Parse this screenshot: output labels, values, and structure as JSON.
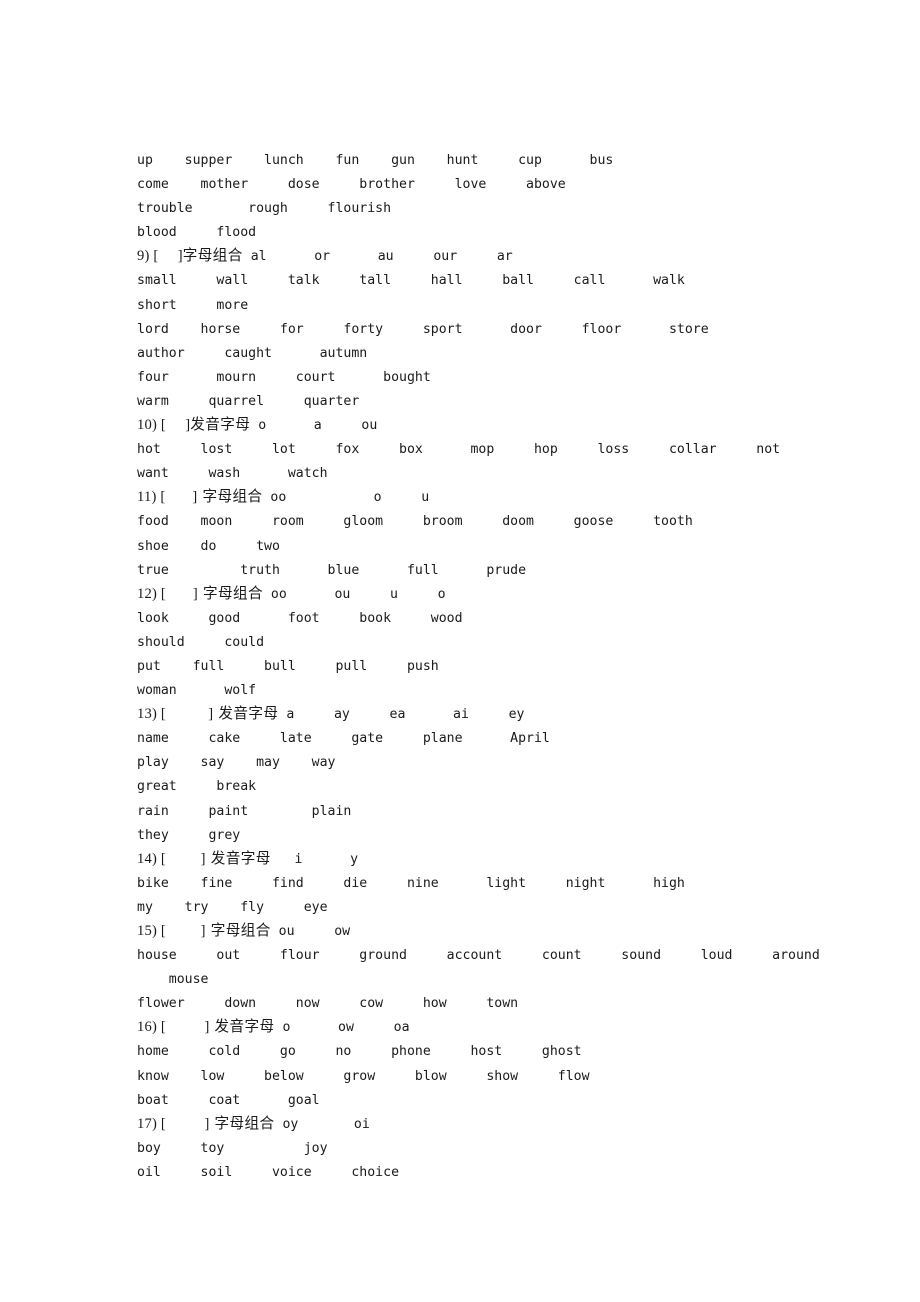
{
  "document": {
    "page_background": "#ffffff",
    "text_color": "#1a1a1a",
    "labels": {
      "pronunciation_letter": "发音字母",
      "letter_combination": "字母组合",
      "bracket_open": "[",
      "bracket_close": "]"
    }
  },
  "lines": [
    {
      "id": "l1",
      "type": "words",
      "indent": 0,
      "text": "up    supper    lunch    fun    gun    hunt     cup      bus"
    },
    {
      "id": "l2",
      "type": "words",
      "indent": 0,
      "text": "come    mother     dose     brother     love     above"
    },
    {
      "id": "l3",
      "type": "words",
      "indent": 0,
      "text": "trouble       rough     flourish"
    },
    {
      "id": "l4",
      "type": "words",
      "indent": 0,
      "text": "blood     flood"
    },
    {
      "id": "l5",
      "type": "header",
      "number": "9)",
      "bracket_gap": 5,
      "label": "字母组合",
      "letters": "al      or      au     our     ar"
    },
    {
      "id": "l6",
      "type": "words",
      "indent": 0,
      "text": "small     wall     talk     tall     hall     ball     call      walk"
    },
    {
      "id": "l7",
      "type": "words",
      "indent": 0,
      "text": "short     more"
    },
    {
      "id": "l8",
      "type": "words",
      "indent": 0,
      "text": "lord    horse     for     forty     sport      door     floor      store"
    },
    {
      "id": "l9",
      "type": "words",
      "indent": 0,
      "text": "author     caught      autumn"
    },
    {
      "id": "l10",
      "type": "words",
      "indent": 0,
      "text": "four      mourn     court      bought"
    },
    {
      "id": "l11",
      "type": "words",
      "indent": 0,
      "text": "warm     quarrel     quarter"
    },
    {
      "id": "l12",
      "type": "header",
      "number": "10)",
      "bracket_gap": 5,
      "label": "发音字母",
      "letters": "o      a     ou"
    },
    {
      "id": "l13",
      "type": "words",
      "indent": 0,
      "text": "hot     lost     lot     fox     box      mop     hop     loss     collar     not"
    },
    {
      "id": "l14",
      "type": "words",
      "indent": 0,
      "text": "want     wash      watch"
    },
    {
      "id": "l15",
      "type": "header",
      "number": "11)",
      "bracket_gap": 7,
      "label": " 字母组合",
      "letters": "oo           o     u"
    },
    {
      "id": "l16",
      "type": "words",
      "indent": 0,
      "text": "food    moon     room     gloom     broom     doom     goose     tooth"
    },
    {
      "id": "l17",
      "type": "words",
      "indent": 0,
      "text": "shoe    do     two"
    },
    {
      "id": "l18",
      "type": "words",
      "indent": 0,
      "text": "true         truth      blue      full      prude"
    },
    {
      "id": "l19",
      "type": "header",
      "number": "12)",
      "bracket_gap": 7,
      "label": " 字母组合",
      "letters": "oo      ou     u     o"
    },
    {
      "id": "l20",
      "type": "words",
      "indent": 0,
      "text": "look     good      foot     book     wood"
    },
    {
      "id": "l21",
      "type": "words",
      "indent": 0,
      "text": "should     could"
    },
    {
      "id": "l22",
      "type": "words",
      "indent": 0,
      "text": "put    full     bull     pull     push"
    },
    {
      "id": "l23",
      "type": "words",
      "indent": 0,
      "text": "woman      wolf"
    },
    {
      "id": "l24",
      "type": "header",
      "number": "13)",
      "bracket_gap": 11,
      "label": " 发音字母",
      "letters": "a     ay     ea      ai     ey"
    },
    {
      "id": "l25",
      "type": "words",
      "indent": 0,
      "text": "name     cake     late     gate     plane      April"
    },
    {
      "id": "l26",
      "type": "words",
      "indent": 0,
      "text": "play    say    may    way"
    },
    {
      "id": "l27",
      "type": "words",
      "indent": 0,
      "text": "great     break"
    },
    {
      "id": "l28",
      "type": "words",
      "indent": 0,
      "text": "rain     paint        plain"
    },
    {
      "id": "l29",
      "type": "words",
      "indent": 0,
      "text": "they     grey"
    },
    {
      "id": "l30",
      "type": "header",
      "number": "14)",
      "bracket_gap": 9,
      "label": " 发音字母",
      "letters": "  i      y"
    },
    {
      "id": "l31",
      "type": "words",
      "indent": 0,
      "text": "bike    fine     find     die     nine      light     night      high"
    },
    {
      "id": "l32",
      "type": "words",
      "indent": 0,
      "text": "my    try    fly     eye"
    },
    {
      "id": "l33",
      "type": "header",
      "number": "15)",
      "bracket_gap": 9,
      "label": " 字母组合",
      "letters": "ou     ow"
    },
    {
      "id": "l34",
      "type": "words",
      "indent": 0,
      "text": "house     out     flour     ground     account     count     sound     loud     around"
    },
    {
      "id": "l35",
      "type": "words",
      "indent": 4,
      "text": "mouse"
    },
    {
      "id": "l36",
      "type": "words",
      "indent": 0,
      "text": "flower     down     now     cow     how     town"
    },
    {
      "id": "l37",
      "type": "header",
      "number": "16)",
      "bracket_gap": 10,
      "label": " 发音字母",
      "letters": "o      ow     oa"
    },
    {
      "id": "l38",
      "type": "words",
      "indent": 0,
      "text": "home     cold     go     no     phone     host     ghost"
    },
    {
      "id": "l39",
      "type": "words",
      "indent": 0,
      "text": "know    low     below     grow     blow     show     flow"
    },
    {
      "id": "l40",
      "type": "words",
      "indent": 0,
      "text": "boat     coat      goal"
    },
    {
      "id": "l41",
      "type": "header",
      "number": "17)",
      "bracket_gap": 10,
      "label": " 字母组合",
      "letters": "oy       oi"
    },
    {
      "id": "l42",
      "type": "words",
      "indent": 0,
      "text": "boy     toy          joy"
    },
    {
      "id": "l43",
      "type": "words",
      "indent": 0,
      "text": "oil     soil     voice     choice"
    }
  ]
}
